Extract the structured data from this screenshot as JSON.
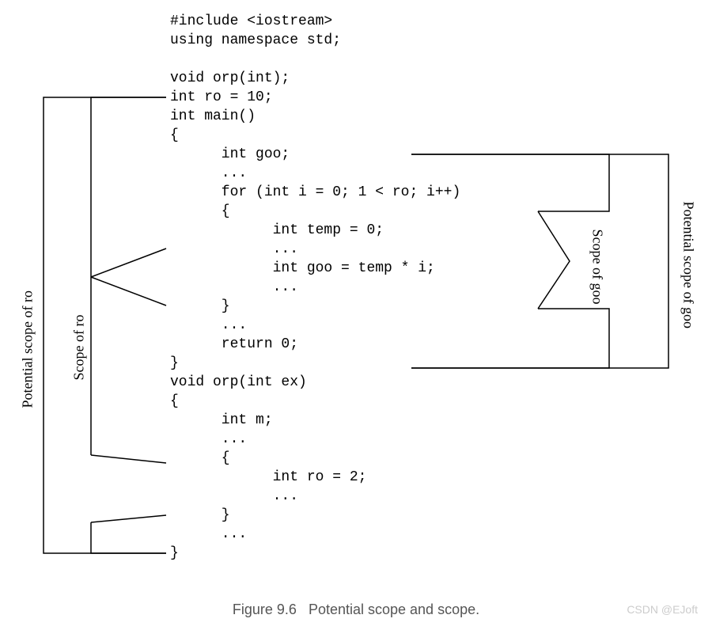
{
  "caption": {
    "figure_label": "Figure 9.6",
    "title": "Potential scope and scope."
  },
  "watermark": "CSDN @EJoft",
  "labels": {
    "potential_scope_ro": "Potential scope of ro",
    "scope_ro": "Scope of ro",
    "potential_scope_goo": "Potential scope of goo",
    "scope_goo": "Scope of goo"
  },
  "code": {
    "l1": "#include <iostream>",
    "l2": "using namespace std;",
    "l3": "",
    "l4": "void orp(int);",
    "l5": "int ro = 10;",
    "l6": "int main()",
    "l7": "{",
    "l8": "      int goo;",
    "l9": "      ...",
    "l10": "      for (int i = 0; 1 < ro; i++)",
    "l11": "      {",
    "l12": "            int temp = 0;",
    "l13": "            ...",
    "l14": "            int goo = temp * i;",
    "l15": "            ...",
    "l16": "      }",
    "l17": "      ...",
    "l18": "      return 0;",
    "l19": "}",
    "l20": "void orp(int ex)",
    "l21": "{",
    "l22": "      int m;",
    "l23": "      ...",
    "l24": "      {",
    "l25": "            int ro = 2;",
    "l26": "            ...",
    "l27": "      }",
    "l28": "      ...",
    "l29": "}"
  }
}
